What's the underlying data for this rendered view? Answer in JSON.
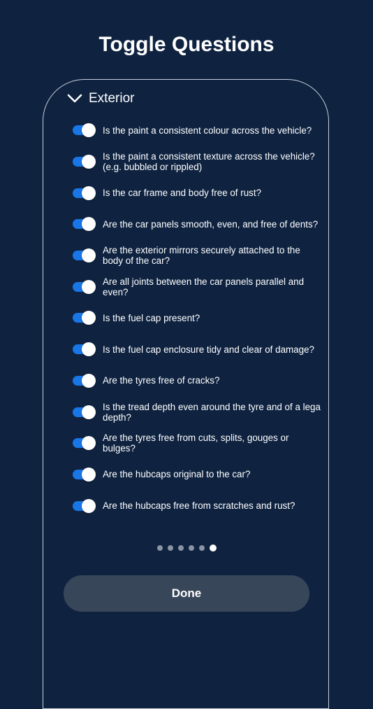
{
  "header": {
    "title": "Toggle Questions"
  },
  "section": {
    "title": "Exterior",
    "icon": "chevron-down-icon",
    "expanded": true
  },
  "questions": [
    {
      "line1": "Is the paint a consistent colour across the vehicle?",
      "line2": "",
      "on": true
    },
    {
      "line1": "Is the paint a consistent texture across the vehicle?",
      "line2": "(e.g. bubbled or rippled)",
      "on": true
    },
    {
      "line1": "Is the car frame and body free of rust?",
      "line2": "",
      "on": true
    },
    {
      "line1": "Are the car panels smooth, even, and free of dents?",
      "line2": "",
      "on": true
    },
    {
      "line1": "Are the exterior mirrors securely attached to the",
      "line2": "body of the car?",
      "on": true
    },
    {
      "line1": "Are all joints between the car panels parallel and",
      "line2": "even?",
      "on": true
    },
    {
      "line1": "Is the fuel cap present?",
      "line2": "",
      "on": true
    },
    {
      "line1": "Is the fuel cap enclosure tidy and clear of damage?",
      "line2": "",
      "on": true
    },
    {
      "line1": "Are the tyres free of cracks?",
      "line2": "",
      "on": true
    },
    {
      "line1": "Is the tread depth even around the tyre and of a lega",
      "line2": "depth?",
      "on": true
    },
    {
      "line1": "Are the tyres free from cuts, splits, gouges or",
      "line2": "bulges?",
      "on": true
    },
    {
      "line1": "Are the hubcaps original to the car?",
      "line2": "",
      "on": true
    },
    {
      "line1": "Are the hubcaps free from scratches and rust?",
      "line2": "",
      "on": true
    }
  ],
  "pager": {
    "total": 6,
    "current": 6
  },
  "footer": {
    "done_label": "Done"
  },
  "colors": {
    "background": "#0f2341",
    "toggle_track_on": "#1976e6",
    "toggle_knob": "#ffffff",
    "button_bg": "#384659",
    "card_border": "#c9d0da"
  }
}
